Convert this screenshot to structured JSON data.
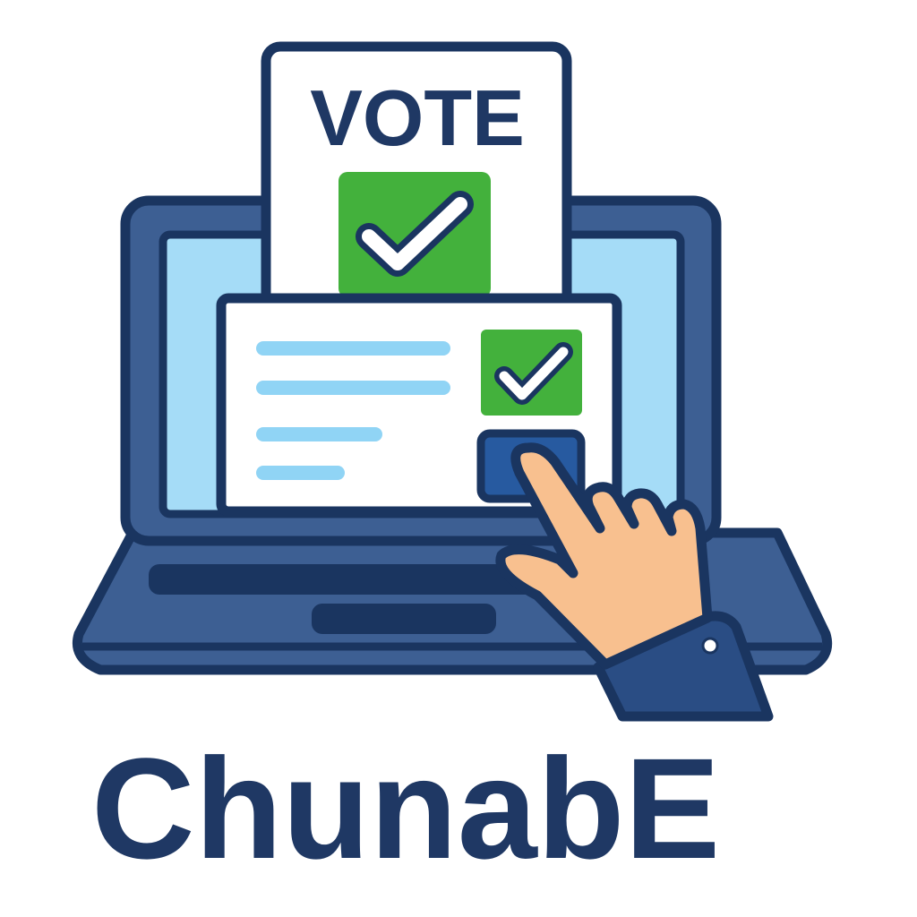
{
  "ballot": {
    "title": "VOTE",
    "checked": true
  },
  "screen_form": {
    "checked": true
  },
  "brand": {
    "name": "ChunabE"
  },
  "icons": [
    "laptop-icon",
    "ballot-paper-icon",
    "checkmark-icon",
    "pointing-hand-icon",
    "submit-button-icon"
  ],
  "colors": {
    "outline": "#1a3560",
    "laptop_body": "#3d5f93",
    "screen_bg": "#a5dcf7",
    "check_green": "#43b13c",
    "form_lines": "#90d4f5",
    "submit_button": "#275aa0",
    "skin": "#f8c08f",
    "sleeve": "#2a4d84",
    "text": "#1f3864"
  }
}
